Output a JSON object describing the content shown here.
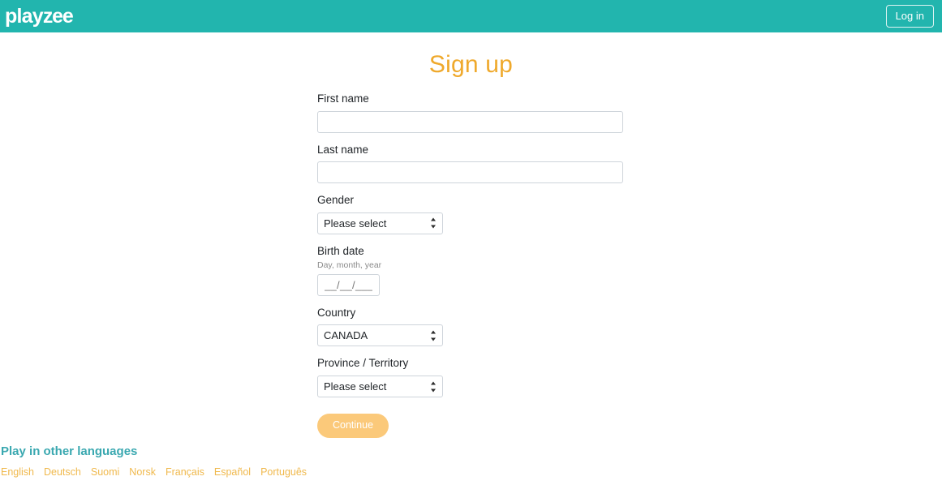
{
  "header": {
    "logo_text": "playzee",
    "logo_part_a": "play",
    "logo_part_b": "zee",
    "login_label": "Log in",
    "background_color": "#22b5ae"
  },
  "page": {
    "title": "Sign up",
    "title_color": "#efa92c"
  },
  "form": {
    "first_name": {
      "label": "First name",
      "value": "",
      "placeholder": ""
    },
    "last_name": {
      "label": "Last name",
      "value": "",
      "placeholder": ""
    },
    "gender": {
      "label": "Gender",
      "selected": "Please select"
    },
    "birth_date": {
      "label": "Birth date",
      "hint": "Day, month, year",
      "value": "",
      "placeholder": "__/__/____"
    },
    "country": {
      "label": "Country",
      "selected": "CANADA"
    },
    "province": {
      "label": "Province / Territory",
      "selected": "Please select"
    },
    "submit": {
      "label": "Continue",
      "color": "#fbc97a"
    }
  },
  "footer": {
    "title": "Play in other languages",
    "title_color": "#3aa8b0",
    "link_color": "#f0b94d",
    "languages": [
      {
        "label": "English"
      },
      {
        "label": "Deutsch"
      },
      {
        "label": "Suomi"
      },
      {
        "label": "Norsk"
      },
      {
        "label": "Français"
      },
      {
        "label": "Español"
      },
      {
        "label": "Português"
      }
    ]
  }
}
